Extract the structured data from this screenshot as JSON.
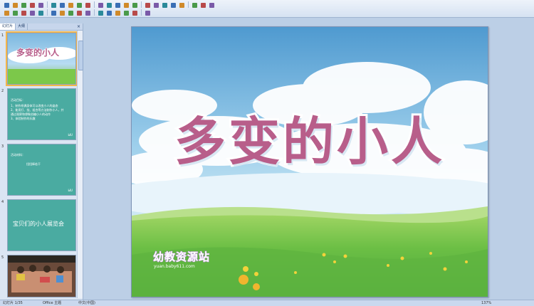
{
  "toolbar": {
    "rows": [
      [
        "new-icon",
        "open-icon",
        "save-icon",
        "permission-icon",
        "email-icon",
        "print-icon",
        "print-preview-icon",
        "spelling-icon",
        "research-icon",
        "cut-icon",
        "copy-icon",
        "paste-icon",
        "format-painter-icon",
        "undo-icon",
        "redo-icon",
        "chart-icon",
        "table-icon",
        "hyperlink-icon",
        "expand-icon",
        "grid-icon",
        "color-icon",
        "zoom-icon",
        "help-icon"
      ],
      [
        "bold-icon",
        "italic-icon",
        "underline-icon",
        "shadow-icon",
        "align-left-icon",
        "center-icon",
        "align-right-icon",
        "numbering-icon",
        "bullets-icon",
        "increase-font-icon",
        "decrease-font-icon",
        "indent-icon",
        "outdent-icon",
        "font-color-icon",
        "design-icon",
        "new-slide-icon"
      ]
    ]
  },
  "left_pane": {
    "tabs": [
      "幻灯片",
      "大纲"
    ],
    "close": "×",
    "slides": [
      {
        "num": "1",
        "title": "多变的小人",
        "type": "title"
      },
      {
        "num": "2",
        "lines": [
          "活动目标：",
          "1、制作纸偶身体可以改变小人的姿态",
          "2、能用打、绕、组合等方法制作小人，并",
          "   通过观察和想象创编小人的动作",
          "3、体验制作的乐趣"
        ],
        "logo": "ЫU"
      },
      {
        "num": "3",
        "lines": [
          "活动材料：",
          "扭扭棒若干"
        ],
        "logo": "ЫU"
      },
      {
        "num": "4",
        "title": "宝贝们的小人展览会",
        "logo": ""
      },
      {
        "num": "5",
        "type": "photo"
      }
    ]
  },
  "slide": {
    "title": "多变的小人",
    "watermark": "幼教资源站",
    "watermark_url": "yuan.baby611.com"
  },
  "status": {
    "slide_info": "幻灯片 1/35",
    "theme": "Office 主题",
    "language": "中文(中国)",
    "zoom": "137%"
  }
}
